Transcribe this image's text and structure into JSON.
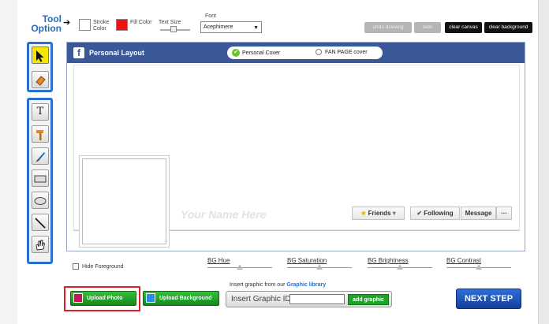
{
  "toolbar": {
    "tool_option": "Tool Option",
    "stroke_label": "Stroke Color",
    "fill_label": "Fill Color",
    "text_size_label": "Text Size",
    "font_label": "Font",
    "font_value": "Acephimere",
    "undo_label": "undo drawing",
    "redo_label": "redo",
    "clear_canvas_label": "clear canvas",
    "clear_background_label": "clear background",
    "stroke_color": "#ffffff",
    "fill_color": "#ee1111"
  },
  "tools": {
    "group1": [
      "select-arrow-icon",
      "eraser-icon"
    ],
    "group2": [
      "text-icon",
      "hammer-icon",
      "brush-icon",
      "rectangle-icon",
      "ellipse-icon",
      "line-icon",
      "hand-icon"
    ],
    "text_glyph": "T"
  },
  "facebook": {
    "title": "Personal Layout",
    "logo_letter": "f",
    "option_personal": "Personal Cover",
    "option_fan": "FAN PAGE cover",
    "name_placeholder": "Your Name Here",
    "friends": "Friends",
    "following": "Following",
    "message": "Message",
    "more": "···",
    "header_color": "#3b5998"
  },
  "controls": {
    "hide_foreground": "Hide Foreground",
    "bg_hue": "BG Hue",
    "bg_saturation": "BG Saturation",
    "bg_brightness": "BG Brightness",
    "bg_contrast": "BG Contrast",
    "insert_caption_prefix": "Insert graphic from our ",
    "graphic_library": "Graphic library",
    "insert_graphic_id": "Insert Graphic ID",
    "add_graphic": "add graphic",
    "upload_photo": "Upload Photo",
    "upload_background": "Upload Background",
    "next_step": "NEXT STEP"
  }
}
